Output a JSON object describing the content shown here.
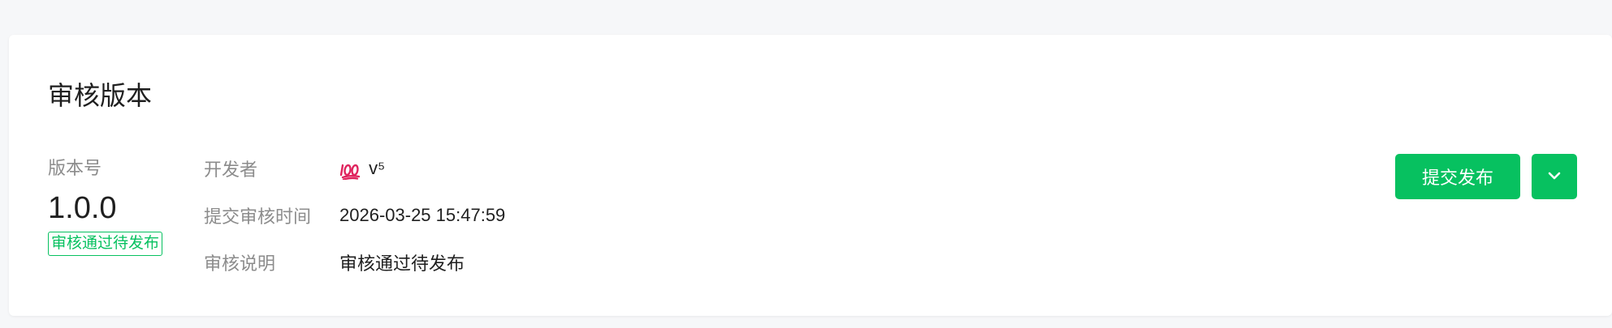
{
  "card": {
    "title": "审核版本"
  },
  "version": {
    "label": "版本号",
    "value": "1.0.0",
    "status": "审核通过待发布"
  },
  "info": {
    "developer_label": "开发者",
    "developer_emoji_icon": "hundred-points-icon",
    "developer_name": "v⁵",
    "submit_time_label": "提交审核时间",
    "submit_time_value": "2026-03-25 15:47:59",
    "review_note_label": "审核说明",
    "review_note_value": "审核通过待发布"
  },
  "actions": {
    "submit_label": "提交发布",
    "more_icon": "chevron-down-icon"
  },
  "colors": {
    "accent": "#07c160",
    "muted_text": "#8c8c8c",
    "main_text": "#1f1f1f",
    "background": "#f6f7f9",
    "card": "#ffffff"
  }
}
